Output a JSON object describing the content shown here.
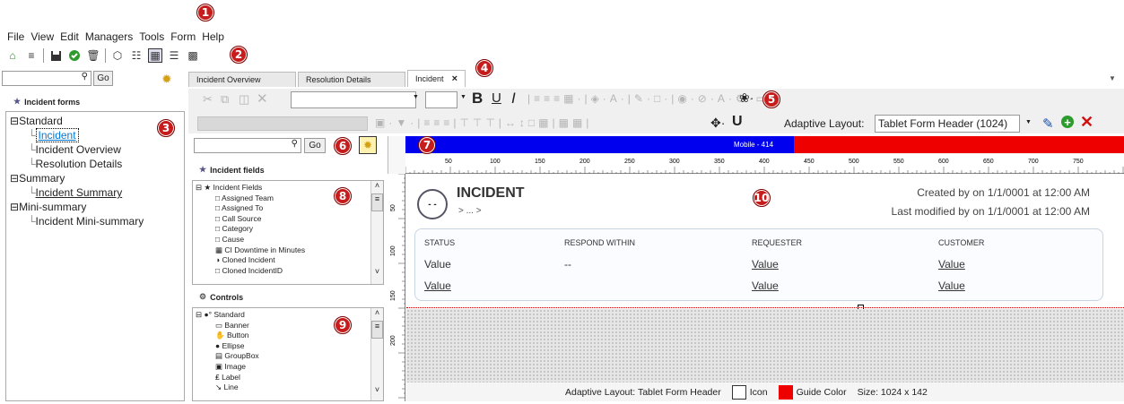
{
  "callouts": [
    "1",
    "2",
    "3",
    "4",
    "5",
    "6",
    "7",
    "8",
    "9",
    "10"
  ],
  "menu": [
    "File",
    "View",
    "Edit",
    "Managers",
    "Tools",
    "Form",
    "Help"
  ],
  "toolbar_icons": [
    "home-icon",
    "list-icon",
    "save-icon",
    "check-icon",
    "trash-icon",
    "cube-icon",
    "hierarchy-icon",
    "layout-icon",
    "menu-icon",
    "folder-icon"
  ],
  "left": {
    "search_go": "Go",
    "header": "Incident forms",
    "tree": {
      "standard": "Standard",
      "incident": "Incident",
      "incident_overview": "Incident Overview",
      "resolution_details": "Resolution Details",
      "summary": "Summary",
      "incident_summary": "Incident Summary",
      "mini_summary": "Mini-summary",
      "incident_mini_summary": "Incident Mini-summary"
    }
  },
  "tabs": {
    "overview": "Incident Overview",
    "resolution": "Resolution Details",
    "incident": "Incident",
    "close": "×"
  },
  "format": {
    "adaptive_label": "Adaptive Layout:",
    "adaptive_value": "Tablet Form Header (1024)"
  },
  "fields": {
    "go": "Go",
    "header": "Incident fields",
    "items": [
      "Incident Fields",
      "Assigned Team",
      "Assigned To",
      "Call Source",
      "Category",
      "Cause",
      "CI Downtime in Minutes",
      "Cloned Incident",
      "Cloned IncidentID"
    ]
  },
  "controls": {
    "header": "Controls",
    "items": [
      "Standard",
      "Banner",
      "Button",
      "Ellipse",
      "GroupBox",
      "Image",
      "Label",
      "Line"
    ]
  },
  "canvas": {
    "mobile_label": "Mobile - 414",
    "ruler_ticks": [
      "50",
      "100",
      "150",
      "200",
      "250",
      "300",
      "350",
      "400",
      "450",
      "500",
      "550",
      "600",
      "650",
      "700",
      "750"
    ],
    "vruler": [
      "50",
      "100",
      "150",
      "200"
    ],
    "avatar": "- -",
    "title": "INCIDENT",
    "breadcrumb": "> ... >",
    "created": "Created by  on 1/1/0001 at 12:00 AM",
    "modified": "Last modified by  on 1/1/0001 at 12:00 AM",
    "card": {
      "labels": [
        "STATUS",
        "RESPOND WITHIN",
        "REQUESTER",
        "CUSTOMER"
      ],
      "row1": [
        "Value",
        "--",
        "Value",
        "Value"
      ],
      "row2": [
        "Value",
        "",
        "Value",
        "Value"
      ]
    }
  },
  "status": {
    "adaptive": "Adaptive Layout: Tablet Form Header",
    "icon": "Icon",
    "guide": "Guide Color",
    "size": "Size: 1024 x 142"
  },
  "colors": {
    "banner_blue": "#0000ee",
    "banner_red": "#ee0000",
    "callout": "#c81c1c",
    "highlight": "#0078d7"
  }
}
